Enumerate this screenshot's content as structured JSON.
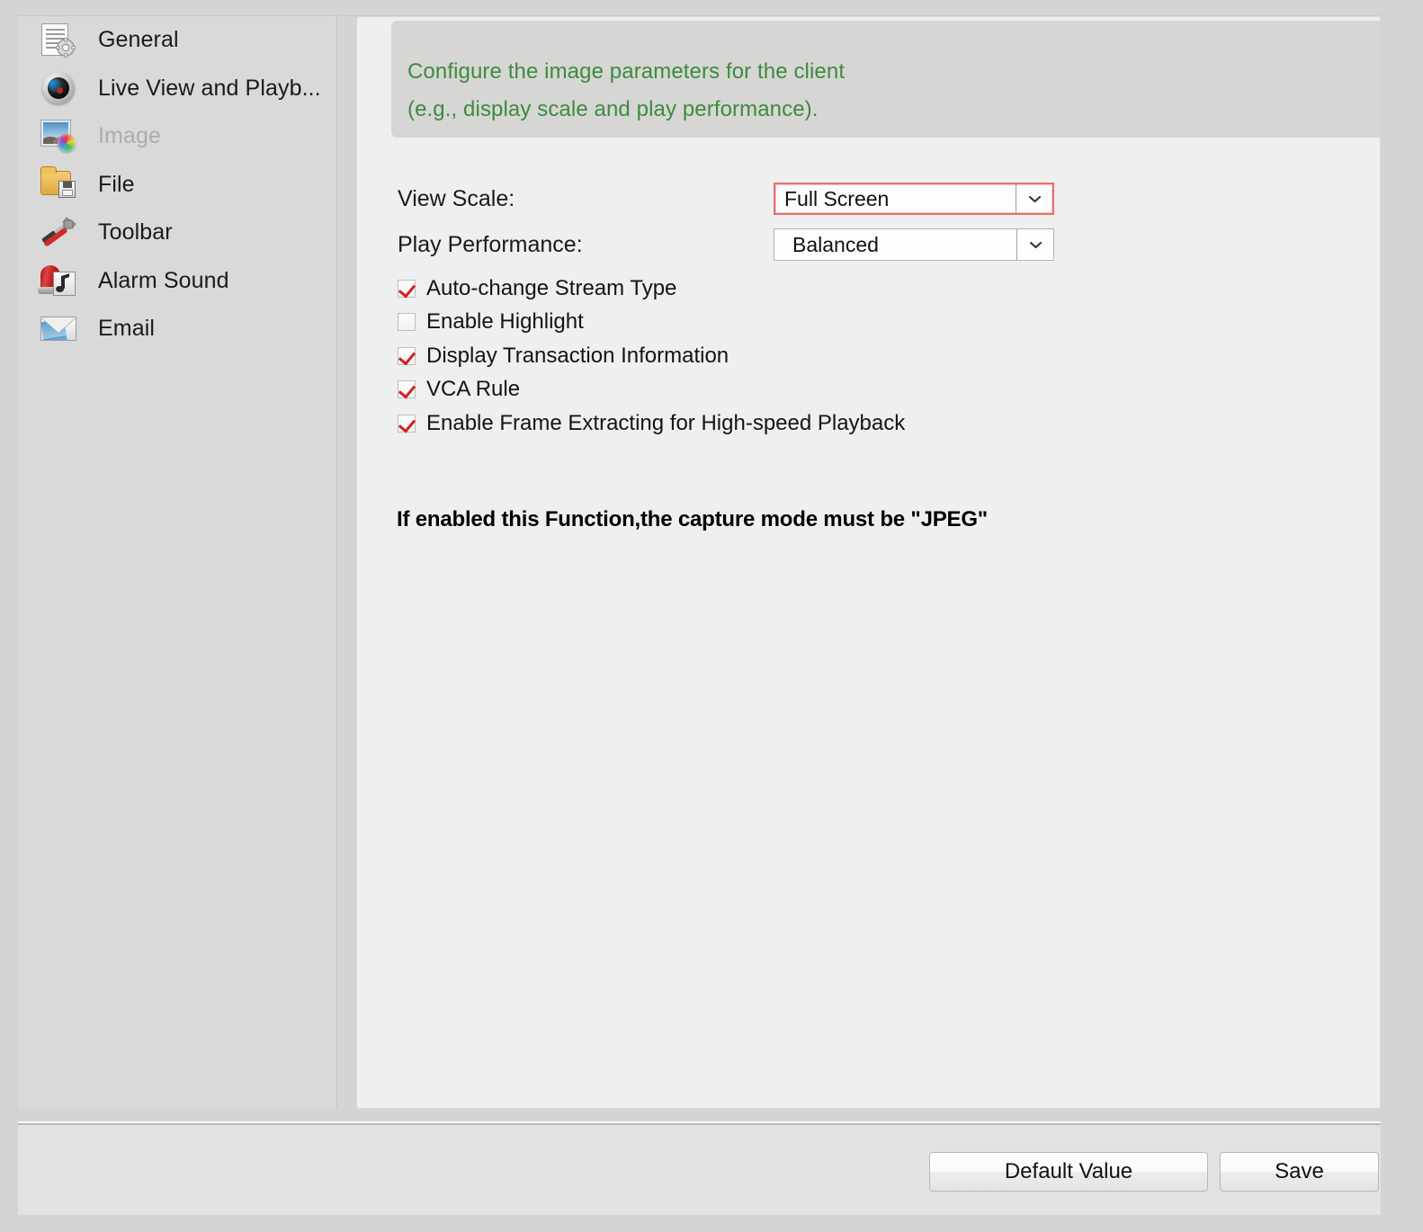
{
  "sidebar": {
    "items": [
      {
        "label": "General",
        "icon": "document-gear-icon",
        "disabled": false
      },
      {
        "label": "Live View and Playb...",
        "icon": "camera-icon",
        "disabled": false
      },
      {
        "label": "Image",
        "icon": "image-color-icon",
        "disabled": true
      },
      {
        "label": "File",
        "icon": "folder-save-icon",
        "disabled": false
      },
      {
        "label": "Toolbar",
        "icon": "hammer-wrench-icon",
        "disabled": false
      },
      {
        "label": "Alarm Sound",
        "icon": "siren-note-icon",
        "disabled": false
      },
      {
        "label": "Email",
        "icon": "envelope-icon",
        "disabled": false
      }
    ]
  },
  "banner": {
    "line1": "Configure the image parameters for the client",
    "line2": "(e.g., display scale and play performance).",
    "text_color": "#3d8b3d",
    "background": "#d6d6d4"
  },
  "form": {
    "view_scale": {
      "label": "View Scale:",
      "value": "Full Screen",
      "focused": true,
      "highlight_color": "#e8706b",
      "arrow_icon": "chevron-down-icon"
    },
    "play_performance": {
      "label": "Play Performance:",
      "value": "Balanced",
      "focused": false,
      "arrow_icon": "chevron-down-icon"
    }
  },
  "checkboxes": [
    {
      "label": "Auto-change Stream Type",
      "checked": true
    },
    {
      "label": "Enable Highlight",
      "checked": false
    },
    {
      "label": "Display Transaction Information",
      "checked": true
    },
    {
      "label": "VCA Rule",
      "checked": true
    },
    {
      "label": "Enable Frame Extracting for High-speed Playback",
      "checked": true
    }
  ],
  "note": "If enabled this Function,the capture mode must be \"JPEG\"",
  "footer": {
    "default_value_label": "Default Value",
    "save_label": "Save"
  },
  "colors": {
    "checkmark": "#cf2020",
    "page_background": "#d4d4d4",
    "panel_background": "#efefef"
  }
}
